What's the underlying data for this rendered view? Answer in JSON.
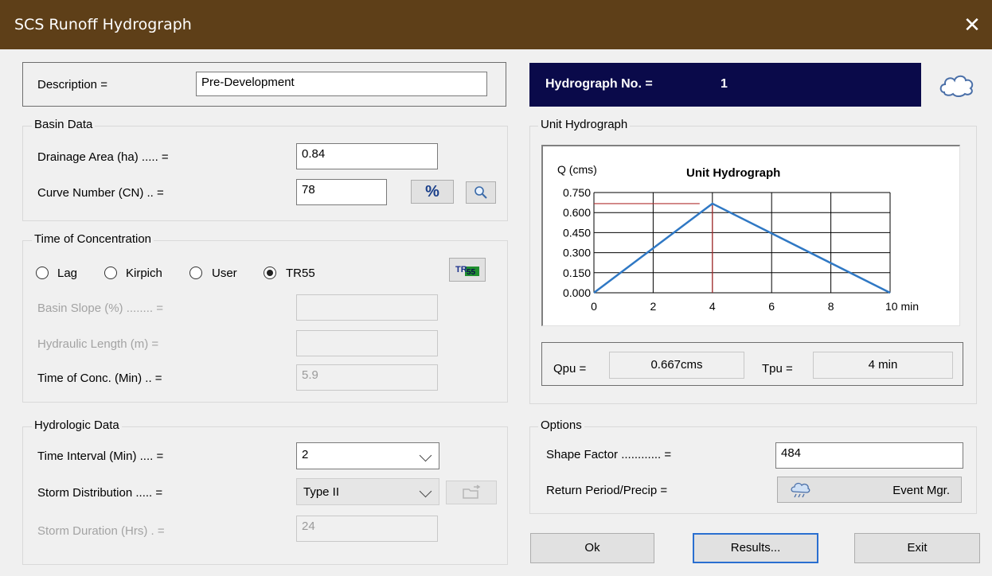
{
  "window": {
    "title": "SCS Runoff Hydrograph"
  },
  "description": {
    "label": "Description =",
    "value": "Pre-Development"
  },
  "hydrograph": {
    "label": "Hydrograph No. =",
    "number": "1"
  },
  "basin": {
    "legend": "Basin Data",
    "area_label": "Drainage Area (ha) ..... =",
    "area_value": "0.84",
    "cn_label": "Curve Number (CN) .. =",
    "cn_value": "78",
    "percent_btn": "%"
  },
  "toc": {
    "legend": "Time of Concentration",
    "radios": [
      {
        "label": "Lag",
        "checked": false
      },
      {
        "label": "Kirpich",
        "checked": false
      },
      {
        "label": "User",
        "checked": false
      },
      {
        "label": "TR55",
        "checked": true
      }
    ],
    "tr55_btn": "TR55",
    "slope_label": "Basin Slope (%) ........ =",
    "slope_value": "",
    "length_label": "Hydraulic Length (m) =",
    "length_value": "",
    "conc_label": "Time of Conc. (Min) .. =",
    "conc_value": "5.9"
  },
  "hydrologic": {
    "legend": "Hydrologic Data",
    "interval_label": "Time Interval (Min) .... =",
    "interval_value": "2",
    "storm_label": "Storm Distribution ..... =",
    "storm_value": "Type II",
    "duration_label": "Storm Duration (Hrs) . =",
    "duration_value": "24"
  },
  "unit_hydrograph": {
    "legend": "Unit Hydrograph",
    "qpu_label": "Qpu =",
    "qpu_value": "0.667cms",
    "tpu_label": "Tpu =",
    "tpu_value": "4 min"
  },
  "chart_data": {
    "type": "line",
    "title": "Unit Hydrograph",
    "ylabel": "Q (cms)",
    "xunit": "min",
    "x": [
      0,
      4,
      10
    ],
    "y": [
      0.0,
      0.667,
      0.0
    ],
    "xticks": [
      "0",
      "2",
      "4",
      "6",
      "8",
      "10 min"
    ],
    "yticks": [
      "0.000",
      "0.150",
      "0.300",
      "0.450",
      "0.600",
      "0.750"
    ],
    "xlim": [
      0,
      10
    ],
    "ylim": [
      0,
      0.75
    ],
    "grid": true,
    "peak": {
      "x": 4,
      "y": 0.667
    },
    "series_color": "#2f78c4",
    "marker_color": "#b03030"
  },
  "options": {
    "legend": "Options",
    "shape_label": "Shape Factor ............ =",
    "shape_value": "484",
    "return_label": "Return Period/Precip  =",
    "event_btn": "Event Mgr."
  },
  "buttons": {
    "ok": "Ok",
    "results": "Results...",
    "exit": "Exit"
  },
  "colors": {
    "titlebar": "#5e3f18",
    "hydro_banner": "#0a0a4a"
  }
}
